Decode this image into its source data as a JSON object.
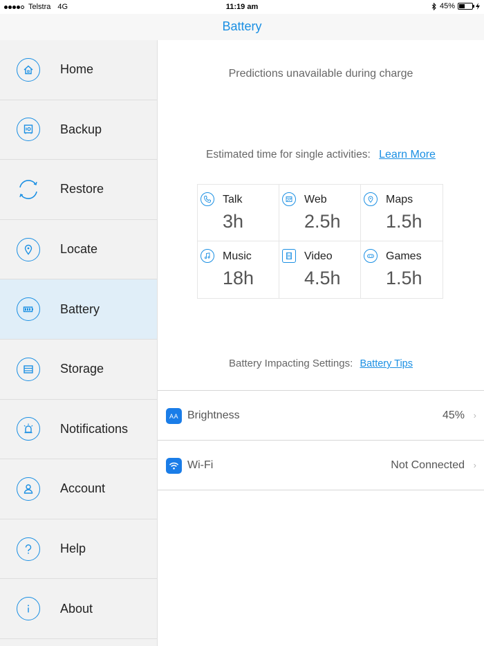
{
  "status_bar": {
    "carrier": "Telstra",
    "network": "4G",
    "time": "11:19 am",
    "battery_percent": "45%"
  },
  "nav": {
    "title": "Battery"
  },
  "sidebar": {
    "items": [
      {
        "label": "Home",
        "icon": "home-icon"
      },
      {
        "label": "Backup",
        "icon": "safe-icon"
      },
      {
        "label": "Restore",
        "icon": "restore-icon"
      },
      {
        "label": "Locate",
        "icon": "location-pin-icon"
      },
      {
        "label": "Battery",
        "icon": "battery-icon",
        "active": true
      },
      {
        "label": "Storage",
        "icon": "storage-icon"
      },
      {
        "label": "Notifications",
        "icon": "alarm-icon"
      },
      {
        "label": "Account",
        "icon": "person-icon"
      },
      {
        "label": "Help",
        "icon": "question-icon"
      },
      {
        "label": "About",
        "icon": "info-icon"
      }
    ]
  },
  "main": {
    "predictions_text": "Predictions unavailable during charge",
    "estimated_text": "Estimated time for single activities:",
    "learn_more": "Learn More",
    "activities": [
      {
        "name": "Talk",
        "value": "3h",
        "icon": "phone-icon"
      },
      {
        "name": "Web",
        "value": "2.5h",
        "icon": "web-icon"
      },
      {
        "name": "Maps",
        "value": "1.5h",
        "icon": "map-pin-icon"
      },
      {
        "name": "Music",
        "value": "18h",
        "icon": "music-note-icon"
      },
      {
        "name": "Video",
        "value": "4.5h",
        "icon": "film-icon"
      },
      {
        "name": "Games",
        "value": "1.5h",
        "icon": "gamepad-icon"
      }
    ],
    "impacting_text": "Battery Impacting Settings:",
    "battery_tips": "Battery Tips",
    "settings": [
      {
        "label": "Brightness",
        "value": "45%",
        "icon": "brightness-icon",
        "icon_text": "AA"
      },
      {
        "label": "Wi-Fi",
        "value": "Not Connected",
        "icon": "wifi-icon"
      }
    ]
  },
  "colors": {
    "accent": "#1a8fe3",
    "active_bg": "#e0eef8",
    "sidebar_bg": "#f2f2f2"
  }
}
